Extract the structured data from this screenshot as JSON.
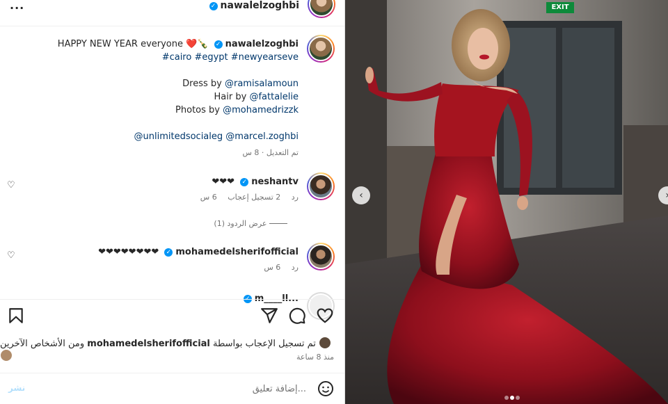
{
  "header": {
    "username": "nawalelzoghbi",
    "more_label": "···"
  },
  "caption": {
    "username": "nawalelzoghbi",
    "text": "HAPPY NEW YEAR everyone ❤️🍾",
    "hashtags": "#cairo #egypt #newyearseve",
    "dress_label": "Dress by",
    "dress_tag": "@ramisalamoun",
    "hair_label": "Hair by",
    "hair_tag": "@fattalelie",
    "photos_label": "Photos by",
    "photos_tag": "@mohamedrizzk",
    "tag_1": "@unlimitedsocialeg",
    "tag_2": "@marcel.zoghbi",
    "edited": "تم التعديل · 8 س"
  },
  "comments": [
    {
      "username": "neshantv",
      "text": "❤❤❤",
      "time": "6 س",
      "likes": "2 تسجيل إعجاب",
      "reply": "رد",
      "view_replies": "عرض الردود (1)"
    },
    {
      "username": "mohamedelsherifofficial",
      "text": "❤❤❤❤❤❤❤❤",
      "time": "6 س",
      "reply": "رد"
    },
    {
      "username": "m____ll..."
    }
  ],
  "likes": {
    "prefix": "تم تسجيل الإعجاب بواسطة",
    "user": "mohamedelsherifofficial",
    "suffix": "ومن الأشخاص الآخرين"
  },
  "post_date": "منذ 8 ساعة",
  "add_comment": {
    "placeholder": "إضافة تعليق...",
    "post_label": "نشر"
  },
  "media": {
    "exit_sign": "EXIT",
    "slide_count": 3,
    "active_slide": 2
  },
  "icons": {
    "like": "heart-icon",
    "comment": "comment-icon",
    "share": "send-icon",
    "save": "bookmark-icon",
    "emoji": "emoji-icon"
  }
}
